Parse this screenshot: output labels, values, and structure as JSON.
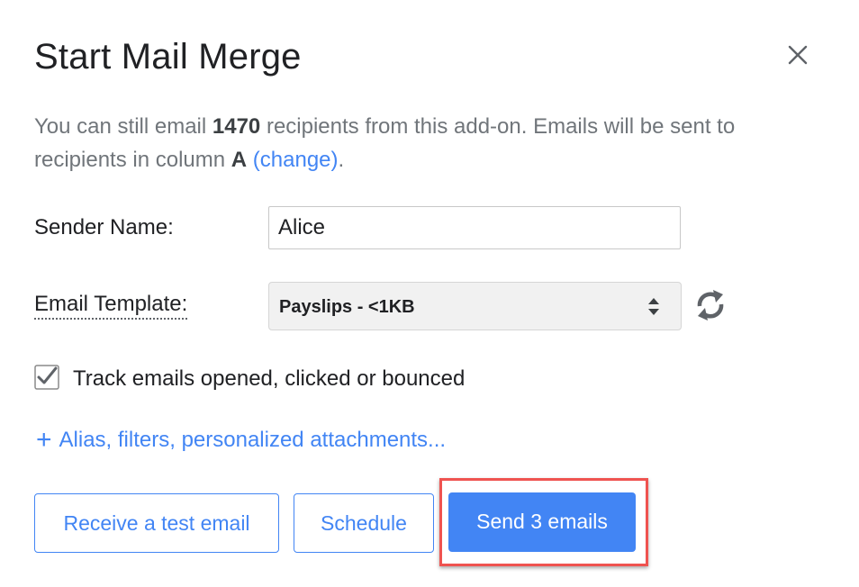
{
  "dialog": {
    "title": "Start Mail Merge",
    "close_icon": "close-icon"
  },
  "info": {
    "prefix": "You can still email ",
    "count": "1470",
    "middle": " recipients from this add-on. Emails will be sent to recipients in column ",
    "column": "A",
    "change_link": "(change)",
    "suffix": "."
  },
  "form": {
    "sender_label": "Sender Name:",
    "sender_value": "Alice",
    "template_label": "Email Template:",
    "template_selected": "Payslips - <1KB",
    "refresh_icon": "refresh-icon",
    "track_checked": true,
    "track_label": "Track emails opened, clicked or bounced",
    "more_plus": "+",
    "more_label": "Alias, filters, personalized attachments..."
  },
  "buttons": {
    "test_label": "Receive a test email",
    "schedule_label": "Schedule",
    "send_label": "Send 3 emails"
  },
  "colors": {
    "accent": "#4285f4",
    "highlight": "#ef5350",
    "muted_text": "#70757a"
  }
}
